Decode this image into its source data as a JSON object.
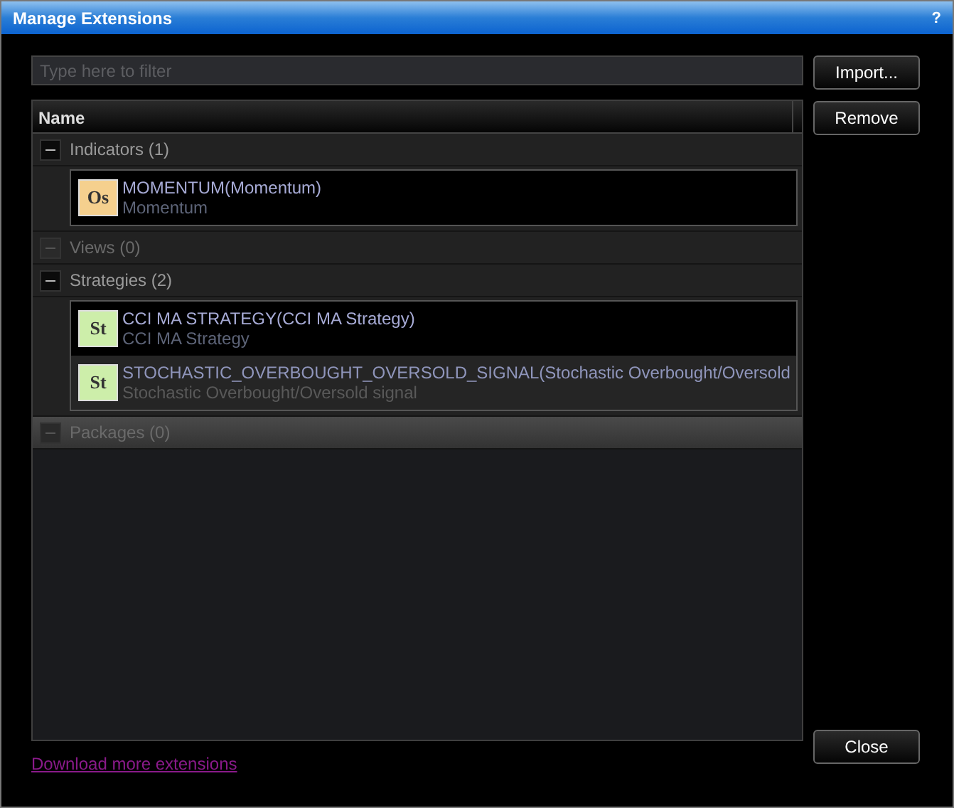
{
  "window": {
    "title": "Manage Extensions",
    "help": "?"
  },
  "filter": {
    "placeholder": "Type here to filter"
  },
  "side_buttons": [
    "Import...",
    "Remove"
  ],
  "table": {
    "columns": [
      "Name"
    ],
    "groups": [
      {
        "label": "Indicators (1)",
        "expanded": true,
        "disabled": false,
        "selected": false,
        "items": [
          {
            "badge": "Os",
            "color": "#f5d08e",
            "name": "MOMENTUM(Momentum)",
            "description": "Momentum",
            "selected": false
          }
        ]
      },
      {
        "label": "Views (0)",
        "expanded": true,
        "disabled": true,
        "selected": false
      },
      {
        "label": "Strategies (2)",
        "expanded": true,
        "disabled": false,
        "selected": false,
        "items": [
          {
            "badge": "St",
            "color": "#cdeeaa",
            "name": "CCI MA STRATEGY(CCI MA Strategy)",
            "description": "CCI MA Strategy",
            "selected": false
          },
          {
            "badge": "St",
            "color": "#cdeeaa",
            "name": "STOCHASTIC_OVERBOUGHT_OVERSOLD_SIGNAL(Stochastic Overbought/Oversold",
            "description": "Stochastic Overbought/Oversold signal",
            "selected": true
          }
        ]
      },
      {
        "label": "Packages (0)",
        "expanded": true,
        "disabled": true,
        "selected": true
      }
    ]
  },
  "link": "Download more extensions",
  "close": "Close"
}
